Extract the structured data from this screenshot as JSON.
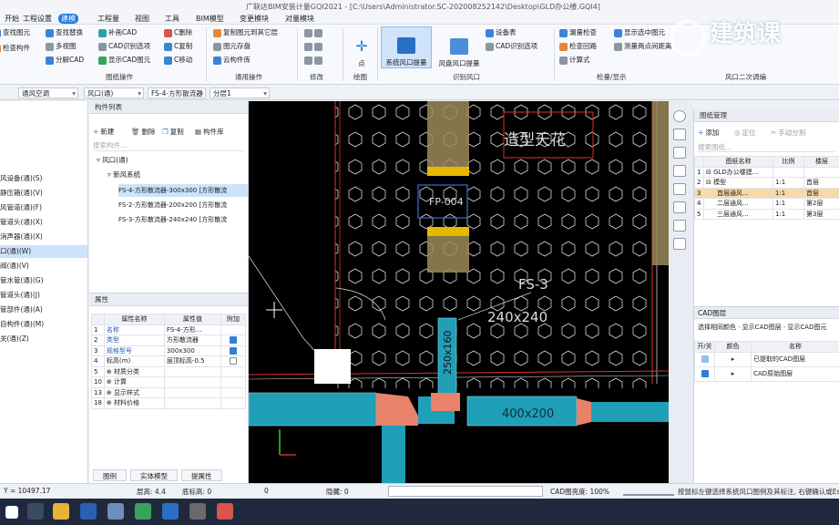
{
  "window": {
    "title": "广联达BIM安装计量GQI2021 - [C:\\Users\\Administrator.SC-202008252142\\Desktop\\GLD办公楼.GQI4]"
  },
  "menu": [
    "开始",
    "工程设置",
    "建模",
    "工程量",
    "视图",
    "工具",
    "BIM模型",
    "变更模块",
    "对量模块"
  ],
  "ribbon": {
    "g1": [
      "查找替换",
      "多视图",
      "分解CAD"
    ],
    "g1b": [
      "查找图元",
      "检查构件"
    ],
    "g2": [
      "补画CAD",
      "CAD识别选项",
      "显示CAD图元"
    ],
    "g2b": [
      "C删除",
      "C复制",
      "C移动"
    ],
    "group_drawing": "图纸操作",
    "g3": [
      "复制图元到其它层",
      "图元存盘",
      "云构件库"
    ],
    "group_general": "通用操作",
    "group_modify": "修改",
    "point": "点",
    "group_draw": "绘图",
    "sys_outlet": "系统风口提量",
    "outlet_extract": "风盘风口提量",
    "equip_table": "设备表",
    "cad_recognize": "CAD识别选项",
    "group_identify": "识别风口",
    "g5": [
      "漏量检查",
      "检查回路",
      "计算式"
    ],
    "g5b": [
      "显示选中图元",
      "测量两点间距离"
    ],
    "group_check": "检量/显示",
    "watermark": "建筑课",
    "group_last": "风口二次调编"
  },
  "selectors": {
    "system": "通风空调",
    "type": "风口(通)",
    "component": "FS-4-方形散流器",
    "floor": "分层1"
  },
  "left_tree": [
    "风设备(通)(S)",
    "静压箱(通)(V)",
    "风管道(通)(F)",
    "管道头(通)(X)",
    "消声器(通)(X)",
    "口(通)(W)",
    "阀(通)(V)",
    "管水管(通)(G)",
    "管道头(通)(J)",
    "管部件(通)(A)",
    "自构件(通)(M)",
    "关(通)(Z)"
  ],
  "comp_list": {
    "header": "构件列表",
    "btn_new": "新建",
    "btn_delete": "删除",
    "btn_copy": "复制",
    "btn_lib": "构件库",
    "search": "搜索构件...",
    "root": "风口(通)",
    "child": "新风系统",
    "items": [
      "FS-4-方形散流器-300x300 [方形散流",
      "FS-2-方形散流器-200x200 [方形散流",
      "FS-3-方形散流器-240x240 [方形散流"
    ]
  },
  "props": {
    "header": "属性",
    "col_name": "属性名称",
    "col_value": "属性值",
    "col_add": "附加",
    "rows": [
      {
        "idx": "1",
        "name": "名称",
        "value": "FS-4-方形..."
      },
      {
        "idx": "2",
        "name": "类型",
        "value": "方形散流器"
      },
      {
        "idx": "3",
        "name": "规格型号",
        "value": "300x300"
      },
      {
        "idx": "4",
        "name": "标高(m)",
        "value": "层顶标高-0.5"
      },
      {
        "idx": "5",
        "name": "⊕ 材质分类",
        "value": ""
      },
      {
        "idx": "10",
        "name": "⊕ 计算",
        "value": ""
      },
      {
        "idx": "13",
        "name": "⊕ 显示样式",
        "value": ""
      },
      {
        "idx": "18",
        "name": "⊕ 材料价格",
        "value": ""
      }
    ]
  },
  "bottom_tabs": [
    "图例",
    "实体模型",
    "提属性"
  ],
  "canvas": {
    "label_ceiling": "造型天花",
    "label_fp": "FP-004",
    "label_fs3": "FS-3",
    "label_240": "240x240",
    "label_250": "250x160",
    "label_400": "400x200"
  },
  "drawing_mgmt": {
    "header": "图纸管理",
    "btn_add": "添加",
    "btn_locate": "定位",
    "btn_hand": "手动分割",
    "search": "搜索图纸...",
    "col_name": "图纸名称",
    "col_ratio": "比例",
    "col_floor": "楼层",
    "rows": [
      {
        "idx": "1",
        "name": "⊟ GLD办公楼建...",
        "ratio": "",
        "floor": ""
      },
      {
        "idx": "2",
        "name": "⊟ 模型",
        "ratio": "1:1",
        "floor": "首层"
      },
      {
        "idx": "3",
        "name": "首层通风...",
        "ratio": "1:1",
        "floor": "首层"
      },
      {
        "idx": "4",
        "name": "二层通风...",
        "ratio": "1:1",
        "floor": "第2层"
      },
      {
        "idx": "5",
        "name": "三层通风...",
        "ratio": "1:1",
        "floor": "第3层"
      }
    ]
  },
  "cad_layers": {
    "header": "CAD图层",
    "filter": "选择相同颜色 · 显示CAD图层 · 显示CAD图元",
    "col_toggle": "开/关",
    "col_color": "颜色",
    "col_name": "名称",
    "rows": [
      "已提取的CAD图层",
      "CAD原始图层"
    ]
  },
  "status": {
    "coord": "Y = 10497.17",
    "floor_height": "层高: 4.4",
    "base_elev": "底标高: 0",
    "zero": "0",
    "hidden": "隐藏: 0",
    "cad_brightness": "CAD图亮度: 100%",
    "hint": "按鼠标左键选择系统风口图例及其标注, 右键确认或Esc"
  },
  "colors": {
    "accent": "#1f79e0",
    "duct_cyan": "#1f9fb8",
    "duct_salmon": "#e8826a",
    "duct_tan": "#9c8a5a"
  }
}
